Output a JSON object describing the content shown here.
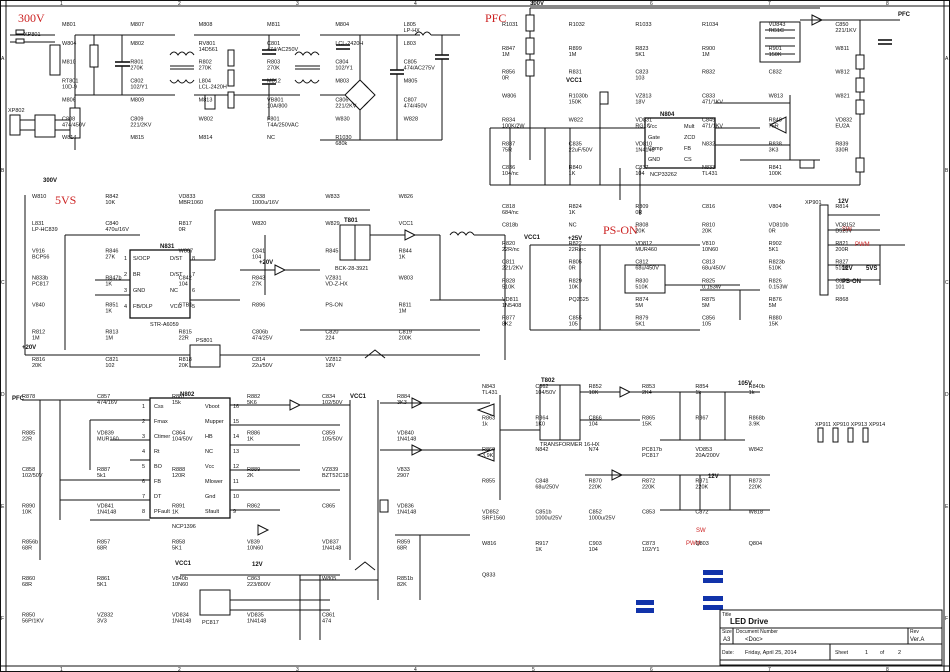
{
  "net_labels": {
    "v300": "300V",
    "pfc_top": "PFC",
    "v5vs": "5VS",
    "ps_on": "PS-ON",
    "v300_small": "300V",
    "v300_right": "300V",
    "pfc_right": "PFC",
    "v12": "12V",
    "v105": "105V",
    "pfc_left": "PFC",
    "vcc1_a": "VCC1",
    "vcc1_b": "VCC1",
    "vcc1_c": "VCC1",
    "vcc1_d": "VCC1",
    "sw": "SW",
    "pwm": "PWM",
    "v12_b": "12V",
    "v5vs_b": "5VS",
    "pson_b": "PS-ON",
    "sw_net": "SW",
    "pwm_net": "PWM",
    "v12_c": "12V",
    "v12_d": "12V",
    "v25": "+25V",
    "v20": "+20V",
    "v20b": "+20V"
  },
  "ic_blocks": {
    "n831": {
      "ref": "N831",
      "part": "STR-A6059",
      "pins_left": [
        "S/OCP",
        "BR",
        "GND",
        "FB/OLP"
      ],
      "pins_right": [
        "D/ST",
        "D/ST",
        "NC",
        "VCC"
      ],
      "nums_left": [
        "1",
        "2",
        "3",
        "4"
      ],
      "nums_right": [
        "8",
        "7",
        "6",
        "5"
      ]
    },
    "n802": {
      "ref": "N802",
      "part": "NCP1396",
      "pins_left": [
        "Css",
        "Fmax",
        "Ctimer",
        "Rt",
        "BO",
        "FB",
        "DT",
        "PFault"
      ],
      "pins_right": [
        "Vboot",
        "Mupper",
        "HB",
        "NC",
        "Vcc",
        "Mlower",
        "Gnd",
        "Sfault"
      ],
      "nums_left": [
        "1",
        "2",
        "3",
        "4",
        "5",
        "6",
        "7",
        "8"
      ],
      "nums_right": [
        "16",
        "15",
        "14",
        "13",
        "12",
        "11",
        "10",
        "9"
      ]
    },
    "n804": {
      "ref": "N804",
      "part": "NCP33262",
      "pins": [
        "Vcc",
        "Gate",
        "Comp",
        "GND",
        "Mult",
        "ZCD",
        "FB",
        "CS"
      ]
    },
    "ps801": {
      "ref": "PS801"
    },
    "ps817": {
      "ref": "PC817"
    },
    "t802": {
      "ref": "T802",
      "part": "TRANSFORMER 16-HX"
    },
    "t801": {
      "ref": "T801",
      "part": "BCK-28-3921"
    },
    "xp801": {
      "ref": "XP801"
    },
    "xp802": {
      "ref": "XP802"
    },
    "xp901": {
      "ref": "XP901"
    },
    "xp911": {
      "ref": "XP911 XP910 XP913 XP914"
    }
  },
  "parts": [
    {
      "ref": "M801"
    },
    {
      "ref": "M807"
    },
    {
      "ref": "M808"
    },
    {
      "ref": "M811"
    },
    {
      "ref": "M804"
    },
    {
      "ref": "L805",
      "val": "LP-HX"
    },
    {
      "ref": "W804"
    },
    {
      "ref": "M802"
    },
    {
      "ref": "RV801",
      "val": "14D561"
    },
    {
      "ref": "C801",
      "val": "474/AC250V"
    },
    {
      "ref": "LCL-2420H"
    },
    {
      "ref": "L803"
    },
    {
      "ref": "M810"
    },
    {
      "ref": "R801",
      "val": "270K"
    },
    {
      "ref": "R802",
      "val": "270K"
    },
    {
      "ref": "R803",
      "val": "270K"
    },
    {
      "ref": "C804",
      "val": "102/Y1"
    },
    {
      "ref": "C805",
      "val": "474/AC275V"
    },
    {
      "ref": "RT801",
      "val": "10D-9"
    },
    {
      "ref": "C802",
      "val": "102/Y1"
    },
    {
      "ref": "L804",
      "val": "LCL-2420H"
    },
    {
      "ref": "M812"
    },
    {
      "ref": "M803"
    },
    {
      "ref": "M805"
    },
    {
      "ref": "M806"
    },
    {
      "ref": "M809"
    },
    {
      "ref": "M813"
    },
    {
      "ref": "VB801",
      "val": "10A/800"
    },
    {
      "ref": "C806",
      "val": "221/2KV"
    },
    {
      "ref": "C807",
      "val": "474/450V"
    },
    {
      "ref": "C808",
      "val": "474/450V"
    },
    {
      "ref": "C809",
      "val": "221/2KV"
    },
    {
      "ref": "W802"
    },
    {
      "ref": "F801",
      "val": "T4A/250VAC"
    },
    {
      "ref": "W830"
    },
    {
      "ref": "W828"
    },
    {
      "ref": "W814"
    },
    {
      "ref": "M815"
    },
    {
      "ref": "M814"
    },
    {
      "ref": "NC"
    },
    {
      "ref": "R1030",
      "val": "680k"
    },
    {
      "ref": "R1031"
    },
    {
      "ref": "R1032"
    },
    {
      "ref": "R1033"
    },
    {
      "ref": "R1034"
    },
    {
      "ref": "VD843",
      "val": "RG1C"
    },
    {
      "ref": "C850",
      "val": "221/1KV"
    },
    {
      "ref": "R847",
      "val": "1M"
    },
    {
      "ref": "R899",
      "val": "1M"
    },
    {
      "ref": "R823",
      "val": "5K1"
    },
    {
      "ref": "R900",
      "val": "1M"
    },
    {
      "ref": "R901",
      "val": "150K"
    },
    {
      "ref": "W811"
    },
    {
      "ref": "R856",
      "val": "0R"
    },
    {
      "ref": "R831"
    },
    {
      "ref": "C823",
      "val": "103"
    },
    {
      "ref": "R832"
    },
    {
      "ref": "C832"
    },
    {
      "ref": "W812"
    },
    {
      "ref": "W806"
    },
    {
      "ref": "R1030b",
      "val": "150K"
    },
    {
      "ref": "VZ813",
      "val": "18V"
    },
    {
      "ref": "C833",
      "val": "471/1KV"
    },
    {
      "ref": "W813"
    },
    {
      "ref": "W821"
    },
    {
      "ref": "R834",
      "val": "100K/2W"
    },
    {
      "ref": "W822"
    },
    {
      "ref": "VD831",
      "val": "RG1C"
    },
    {
      "ref": "C849",
      "val": "471/1KV"
    },
    {
      "ref": "R848",
      "val": "75R"
    },
    {
      "ref": "VD832",
      "val": "EU2A"
    },
    {
      "ref": "R837",
      "val": "75R"
    },
    {
      "ref": "C835",
      "val": "22uF/50V"
    },
    {
      "ref": "VD810",
      "val": "1N4148"
    },
    {
      "ref": "N832"
    },
    {
      "ref": "R838",
      "val": "3K3"
    },
    {
      "ref": "R839",
      "val": "330R"
    },
    {
      "ref": "C836",
      "val": "104/nc"
    },
    {
      "ref": "R840",
      "val": "1K"
    },
    {
      "ref": "C837",
      "val": "104"
    },
    {
      "ref": "N833",
      "val": "TL431"
    },
    {
      "ref": "R841",
      "val": "100K"
    },
    {
      "ref": "W810"
    },
    {
      "ref": "R842",
      "val": "10K"
    },
    {
      "ref": "VD833",
      "val": "MBR1060"
    },
    {
      "ref": "C838",
      "val": "1000u/16V"
    },
    {
      "ref": "W833"
    },
    {
      "ref": "W826"
    },
    {
      "ref": "L831",
      "val": "LP-HC839"
    },
    {
      "ref": "C840",
      "val": "470u/16V"
    },
    {
      "ref": "R817",
      "val": "0R"
    },
    {
      "ref": "W820"
    },
    {
      "ref": "W829"
    },
    {
      "ref": "VCC1"
    },
    {
      "ref": "V916",
      "val": "BCP56"
    },
    {
      "ref": "R846",
      "val": "27K"
    },
    {
      "ref": "W807"
    },
    {
      "ref": "C841",
      "val": "104"
    },
    {
      "ref": "R845"
    },
    {
      "ref": "R844",
      "val": "1K"
    },
    {
      "ref": "N833b",
      "val": "PC817"
    },
    {
      "ref": "R847b",
      "val": "1K"
    },
    {
      "ref": "C842",
      "val": "104"
    },
    {
      "ref": "R843",
      "val": "27K"
    },
    {
      "ref": "VZ831",
      "val": "VD-Z-HX"
    },
    {
      "ref": "W803"
    },
    {
      "ref": "V840"
    },
    {
      "ref": "R851",
      "val": "1K"
    },
    {
      "ref": "STB1"
    },
    {
      "ref": "R896"
    },
    {
      "ref": "PS-ON"
    },
    {
      "ref": "R811",
      "val": "1M"
    },
    {
      "ref": "R812",
      "val": "1M"
    },
    {
      "ref": "R813",
      "val": "1M"
    },
    {
      "ref": "R815",
      "val": "22R"
    },
    {
      "ref": "C806b",
      "val": "474/25V"
    },
    {
      "ref": "C820",
      "val": "224"
    },
    {
      "ref": "C819",
      "val": "200K"
    },
    {
      "ref": "R816",
      "val": "20K"
    },
    {
      "ref": "C821",
      "val": "102"
    },
    {
      "ref": "R818",
      "val": "20K"
    },
    {
      "ref": "C814",
      "val": "22u/50V"
    },
    {
      "ref": "VZ812",
      "val": "18V"
    },
    {
      "ref": "C818",
      "val": "684/nc"
    },
    {
      "ref": "R824",
      "val": "1K"
    },
    {
      "ref": "R809",
      "val": "0R"
    },
    {
      "ref": "C816"
    },
    {
      "ref": "V804"
    },
    {
      "ref": "R814"
    },
    {
      "ref": "C818b"
    },
    {
      "ref": "NC"
    },
    {
      "ref": "R808",
      "val": "20K"
    },
    {
      "ref": "R810",
      "val": "20K"
    },
    {
      "ref": "VD810b",
      "val": "0R"
    },
    {
      "ref": "VD8152",
      "val": "D520V"
    },
    {
      "ref": "R820",
      "val": "22R/nc"
    },
    {
      "ref": "R822",
      "val": "22R/nc"
    },
    {
      "ref": "VD812",
      "val": "MUR460"
    },
    {
      "ref": "V810",
      "val": "10N60"
    },
    {
      "ref": "R902",
      "val": "5K1"
    },
    {
      "ref": "R821",
      "val": "200R"
    },
    {
      "ref": "C811",
      "val": "221/2KV"
    },
    {
      "ref": "R805",
      "val": "0R"
    },
    {
      "ref": "C812",
      "val": "68u/450V"
    },
    {
      "ref": "C813",
      "val": "68u/450V"
    },
    {
      "ref": "R823b",
      "val": "510K"
    },
    {
      "ref": "R827",
      "val": "510K"
    },
    {
      "ref": "R828",
      "val": "510K"
    },
    {
      "ref": "R829",
      "val": "10K"
    },
    {
      "ref": "R830",
      "val": "510K"
    },
    {
      "ref": "R825",
      "val": "0.153W"
    },
    {
      "ref": "R826",
      "val": "0.153W"
    },
    {
      "ref": "C851",
      "val": "101"
    },
    {
      "ref": "VD811",
      "val": "1N5408"
    },
    {
      "ref": "PQ2625"
    },
    {
      "ref": "R874",
      "val": "5M"
    },
    {
      "ref": "R875",
      "val": "5M"
    },
    {
      "ref": "R876",
      "val": "5M"
    },
    {
      "ref": "R868"
    },
    {
      "ref": "R877",
      "val": "8K2"
    },
    {
      "ref": "C855",
      "val": "105"
    },
    {
      "ref": "R879",
      "val": "5K1"
    },
    {
      "ref": "C856",
      "val": "105"
    },
    {
      "ref": "R880",
      "val": "15K"
    },
    {
      "ref": "R878"
    },
    {
      "ref": "C857",
      "val": "474/16V"
    },
    {
      "ref": "R881",
      "val": "15k"
    },
    {
      "ref": "R882",
      "val": "5K6"
    },
    {
      "ref": "C834",
      "val": "102/50V"
    },
    {
      "ref": "R884",
      "val": "3K3"
    },
    {
      "ref": "R885",
      "val": "22R"
    },
    {
      "ref": "VD839",
      "val": "MUR160"
    },
    {
      "ref": "C864",
      "val": "104/50V"
    },
    {
      "ref": "R886",
      "val": "1K"
    },
    {
      "ref": "C859",
      "val": "105/50V"
    },
    {
      "ref": "VD840",
      "val": "1N4148"
    },
    {
      "ref": "C858",
      "val": "102/50V"
    },
    {
      "ref": "R887",
      "val": "5k1"
    },
    {
      "ref": "R888",
      "val": "120R"
    },
    {
      "ref": "R889",
      "val": "2K"
    },
    {
      "ref": "VZ839",
      "val": "BZT52C18"
    },
    {
      "ref": "V833",
      "val": "2907"
    },
    {
      "ref": "R890",
      "val": "10K"
    },
    {
      "ref": "VD841",
      "val": "1N4148"
    },
    {
      "ref": "R891",
      "val": "1K"
    },
    {
      "ref": "R862"
    },
    {
      "ref": "C865"
    },
    {
      "ref": "VD836",
      "val": "1N4148"
    },
    {
      "ref": "R856b",
      "val": "68R"
    },
    {
      "ref": "R857",
      "val": "68R"
    },
    {
      "ref": "R858",
      "val": "5K1"
    },
    {
      "ref": "V839",
      "val": "10N60"
    },
    {
      "ref": "VD837",
      "val": "1N4148"
    },
    {
      "ref": "R859",
      "val": "68R"
    },
    {
      "ref": "R860",
      "val": "68R"
    },
    {
      "ref": "R861",
      "val": "5K1"
    },
    {
      "ref": "V840b",
      "val": "10N60"
    },
    {
      "ref": "C863",
      "val": "223/800V"
    },
    {
      "ref": "W805"
    },
    {
      "ref": "R851b",
      "val": "82K"
    },
    {
      "ref": "R850",
      "val": "56P/1KV"
    },
    {
      "ref": "VZ832",
      "val": "3V3"
    },
    {
      "ref": "VD834",
      "val": "1N4148"
    },
    {
      "ref": "VD835",
      "val": "1N4148"
    },
    {
      "ref": "C861",
      "val": "474"
    },
    {
      "ref": "N843",
      "val": "TL431"
    },
    {
      "ref": "C862",
      "val": "104/50V"
    },
    {
      "ref": "R852",
      "val": "10K"
    },
    {
      "ref": "R853",
      "val": "2K4"
    },
    {
      "ref": "R854",
      "val": "1k"
    },
    {
      "ref": "R840b",
      "val": "1k"
    },
    {
      "ref": "R863",
      "val": "1k"
    },
    {
      "ref": "R864",
      "val": "1K0"
    },
    {
      "ref": "C866",
      "val": "104"
    },
    {
      "ref": "R865",
      "val": "15K"
    },
    {
      "ref": "R867"
    },
    {
      "ref": "R868b",
      "val": "3.9K"
    },
    {
      "ref": "R869",
      "val": "3.9K"
    },
    {
      "ref": "N842"
    },
    {
      "ref": "N74"
    },
    {
      "ref": "PC817b",
      "val": "PC817"
    },
    {
      "ref": "VD853",
      "val": "20A/200V"
    },
    {
      "ref": "W842"
    },
    {
      "ref": "R855"
    },
    {
      "ref": "C848",
      "val": "68u/250V"
    },
    {
      "ref": "R870",
      "val": "220K"
    },
    {
      "ref": "R872",
      "val": "220K"
    },
    {
      "ref": "R871",
      "val": "220K"
    },
    {
      "ref": "R873",
      "val": "220K"
    },
    {
      "ref": "VD852",
      "val": "SRF1560"
    },
    {
      "ref": "C851b",
      "val": "1000u/25V"
    },
    {
      "ref": "C852",
      "val": "1000u/25V"
    },
    {
      "ref": "C853"
    },
    {
      "ref": "C872"
    },
    {
      "ref": "W818"
    },
    {
      "ref": "W816"
    },
    {
      "ref": "R917",
      "val": "1K"
    },
    {
      "ref": "C903",
      "val": "104"
    },
    {
      "ref": "C873",
      "val": "102/Y1"
    },
    {
      "ref": "Q803"
    },
    {
      "ref": "Q804"
    },
    {
      "ref": "Q833"
    }
  ],
  "title_block": {
    "title_label": "Title",
    "title": "LED Drive",
    "size_label": "Size",
    "size": "A3",
    "docnum_label": "Document Number",
    "docnum": "<Doc>",
    "rev_label": "Rev",
    "rev": "Ver.A",
    "date_label": "Date:",
    "date": "Friday, April 25, 2014",
    "sheet_label": "Sheet",
    "sheet": "1",
    "of_label": "of",
    "total": "2"
  },
  "border": {
    "cols": [
      "1",
      "2",
      "3",
      "4",
      "5",
      "6",
      "7",
      "8"
    ],
    "rows": [
      "A",
      "B",
      "C",
      "D",
      "E",
      "F"
    ]
  },
  "colors": {
    "net_red": "#cc2222",
    "blue": "#1133aa",
    "ink": "#111111"
  }
}
